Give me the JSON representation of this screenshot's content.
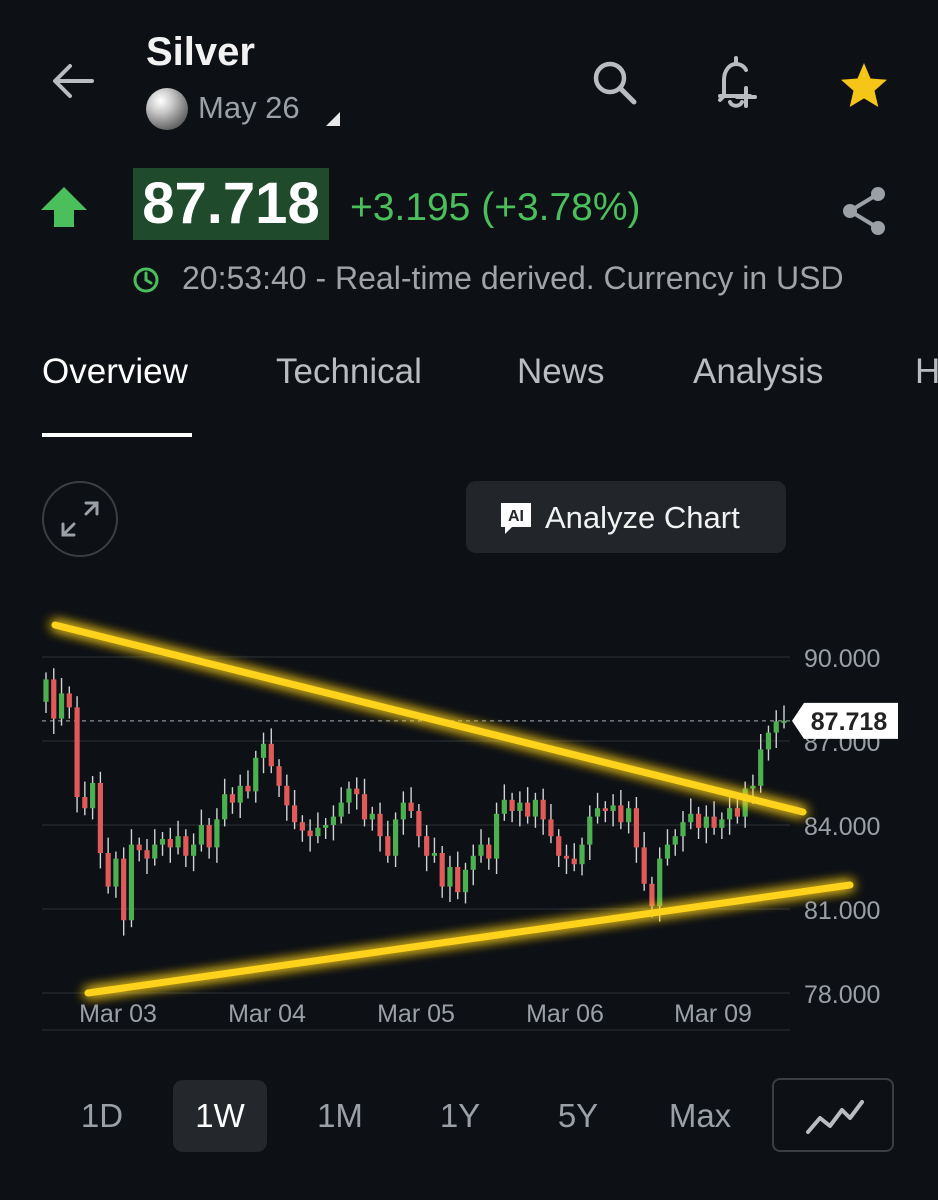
{
  "header": {
    "back_icon": "arrow-left-icon",
    "title": "Silver",
    "contract": "May 26",
    "actions": [
      "search-icon",
      "bell-plus-icon",
      "star-icon"
    ],
    "star_color": "#f5c518"
  },
  "quote": {
    "direction_icon": "arrow-up-icon",
    "price": "87.718",
    "change": "+3.195 (+3.78%)",
    "time_status": "20:53:40 - Real-time derived. Currency in USD",
    "share_icon": "share-icon",
    "up_color": "#4bbf5b"
  },
  "tabs": [
    {
      "label": "Overview",
      "active": true
    },
    {
      "label": "Technical",
      "active": false
    },
    {
      "label": "News",
      "active": false
    },
    {
      "label": "Analysis",
      "active": false
    },
    {
      "label": "H",
      "active": false
    }
  ],
  "toolbar": {
    "expand_icon": "expand-icon",
    "analyze_icon": "ai-chat-icon",
    "analyze_label": "Analyze Chart"
  },
  "chart_data": {
    "type": "candlestick",
    "ylim": [
      78,
      91.2
    ],
    "y_ticks": [
      "90.000",
      "87.000",
      "84.000",
      "81.000",
      "78.000"
    ],
    "x_ticks": [
      "Mar 03",
      "Mar 04",
      "Mar 05",
      "Mar 06",
      "Mar 09"
    ],
    "last_price_label": "87.718",
    "last_price": 87.718,
    "up_color": "#4caf50",
    "down_color": "#e05a5a",
    "trendline_color": "#ffd21e",
    "closes": [
      89.2,
      87.8,
      88.7,
      88.2,
      85.0,
      84.6,
      85.5,
      83.0,
      81.8,
      82.8,
      80.6,
      83.3,
      83.1,
      82.8,
      83.3,
      83.5,
      83.2,
      83.6,
      82.9,
      83.3,
      84.0,
      83.2,
      84.2,
      85.1,
      84.8,
      85.4,
      85.2,
      86.4,
      86.9,
      86.1,
      85.4,
      84.7,
      84.1,
      83.8,
      83.6,
      83.9,
      84.0,
      84.3,
      84.8,
      85.3,
      85.1,
      84.2,
      84.4,
      83.6,
      82.9,
      84.2,
      84.8,
      84.5,
      83.6,
      82.9,
      83.0,
      81.8,
      82.5,
      81.6,
      82.4,
      82.9,
      83.3,
      82.8,
      84.4,
      84.9,
      84.5,
      84.8,
      84.3,
      84.9,
      84.2,
      83.6,
      82.9,
      82.8,
      82.6,
      83.3,
      84.3,
      84.6,
      84.5,
      84.7,
      84.1,
      84.6,
      83.2,
      81.9,
      81.1,
      82.8,
      83.3,
      83.6,
      84.1,
      84.4,
      83.9,
      84.3,
      83.9,
      84.2,
      84.6,
      84.3,
      85.3,
      85.4,
      86.7,
      87.3,
      87.7,
      87.718
    ]
  },
  "ranges": [
    {
      "label": "1D",
      "active": false
    },
    {
      "label": "1W",
      "active": true
    },
    {
      "label": "1M",
      "active": false
    },
    {
      "label": "1Y",
      "active": false
    },
    {
      "label": "5Y",
      "active": false
    },
    {
      "label": "Max",
      "active": false
    }
  ],
  "chart_type_icon": "line-chart-icon"
}
